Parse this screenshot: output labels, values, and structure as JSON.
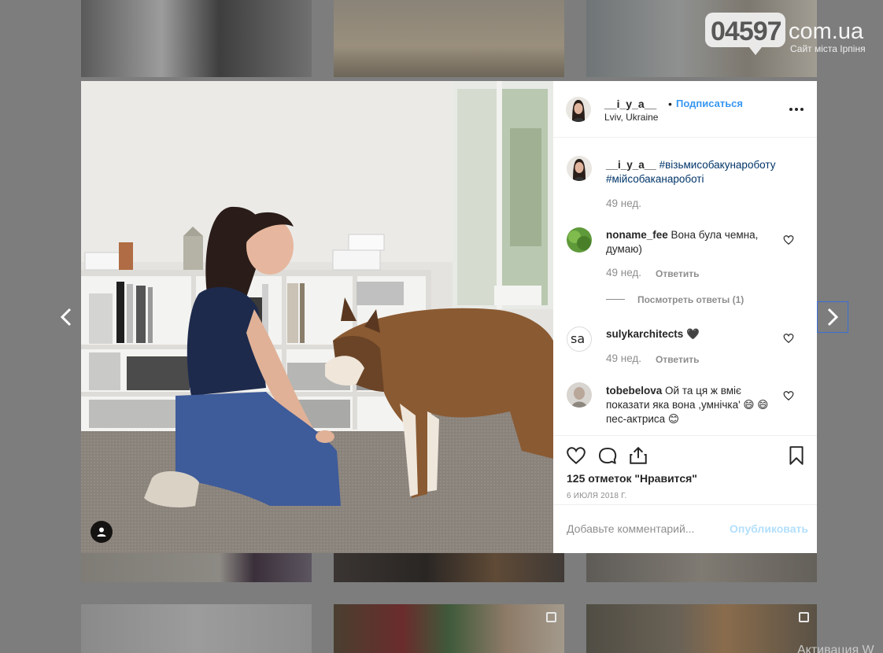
{
  "site": {
    "logo_number": "04597",
    "logo_domain": "com.ua",
    "logo_subtitle": "Сайт міста Ірпіня"
  },
  "post": {
    "author": "__i_y_a__",
    "follow_label": "Подписаться",
    "location": "Lviv, Ukraine",
    "caption_hashtags": [
      "#візьмисобакунароботу",
      "#мійсобаканароботі"
    ],
    "caption_age": "49 нед.",
    "likes": "125 отметок \"Нравится\"",
    "date": "6 ИЮЛЯ 2018 Г.",
    "comment_placeholder": "Добавьте комментарий...",
    "publish_label": "Опубликовать"
  },
  "comments": [
    {
      "user": "noname_fee",
      "text": "Вона була чемна, думаю)",
      "age": "49 нед.",
      "reply_label": "Ответить",
      "view_replies": "Посмотреть ответы (1)"
    },
    {
      "user": "sulykarchitects",
      "text": "🖤",
      "avatar_text": "sa",
      "age": "49 нед.",
      "reply_label": "Ответить"
    },
    {
      "user": "tobebelova",
      "text": "Ой та ця ж вміє показати яка вона ,умнічка' 😄 😄 пес-актриса 😊"
    }
  ],
  "footer_overlay": "Активация W",
  "colors": {
    "follow_blue": "#3897f0",
    "hashtag_blue": "#003569",
    "publish_disabled": "#b2dffc",
    "backdrop": "#7d7d7d"
  },
  "icons": [
    "chevron-left-icon",
    "chevron-right-icon",
    "more-options-icon",
    "heart-icon",
    "comment-icon",
    "share-icon",
    "bookmark-icon",
    "user-tag-icon"
  ]
}
